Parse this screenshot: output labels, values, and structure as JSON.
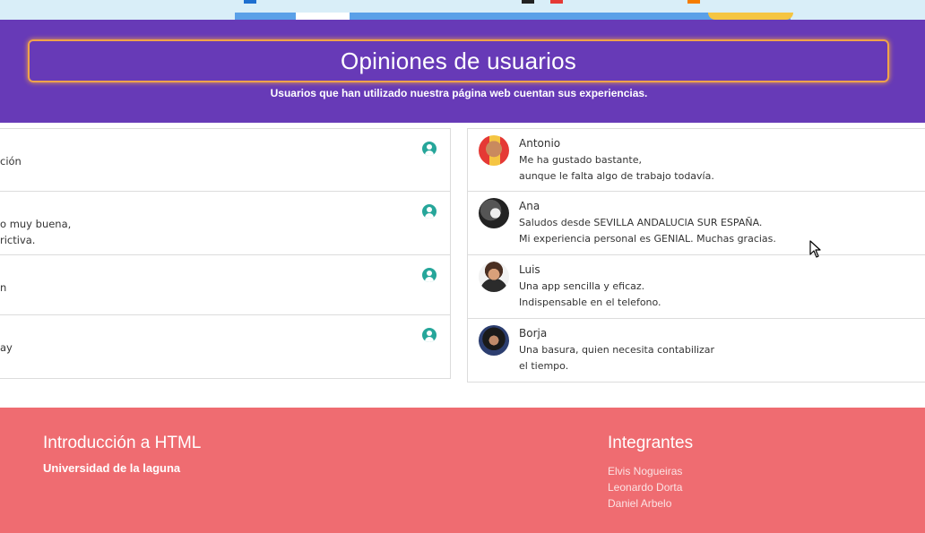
{
  "header": {
    "title": "Opiniones de usuarios",
    "subtitle": "Usuarios que han utilizado nuestra página web cuentan sus experiencias."
  },
  "left_cards": [
    {
      "line1": "",
      "line2": "ción"
    },
    {
      "line1": "o muy buena,",
      "line2": "rictiva."
    },
    {
      "line1": "",
      "line2": "n"
    },
    {
      "line1": "",
      "line2": "ay"
    }
  ],
  "right_cards": [
    {
      "name": "Antonio",
      "line1": "Me ha gustado bastante,",
      "line2": "aunque le falta algo de trabajo todavía."
    },
    {
      "name": "Ana",
      "line1": "Saludos desde SEVILLA ANDALUCIA SUR ESPAÑA.",
      "line2": "Mi experiencia personal es GENIAL. Muchas gracias."
    },
    {
      "name": "Luis",
      "line1": "Una app sencilla y eficaz.",
      "line2": "Indispensable en el telefono."
    },
    {
      "name": "Borja",
      "line1": "Una basura, quien necesita contabilizar",
      "line2": "el tiempo."
    }
  ],
  "footer": {
    "left_title": "Introducción a HTML",
    "left_sub": "Universidad de la laguna",
    "right_title": "Integrantes",
    "members": [
      "Elvis Nogueiras",
      "Leonardo Dorta",
      "Daniel Arbelo"
    ]
  },
  "colors": {
    "header_bg": "#673ab7",
    "title_border": "#f0a34a",
    "footer_bg": "#ef6c71",
    "user_icon": "#26a69a"
  },
  "icons": [
    "user-circle-icon",
    "mouse-pointer-icon"
  ]
}
